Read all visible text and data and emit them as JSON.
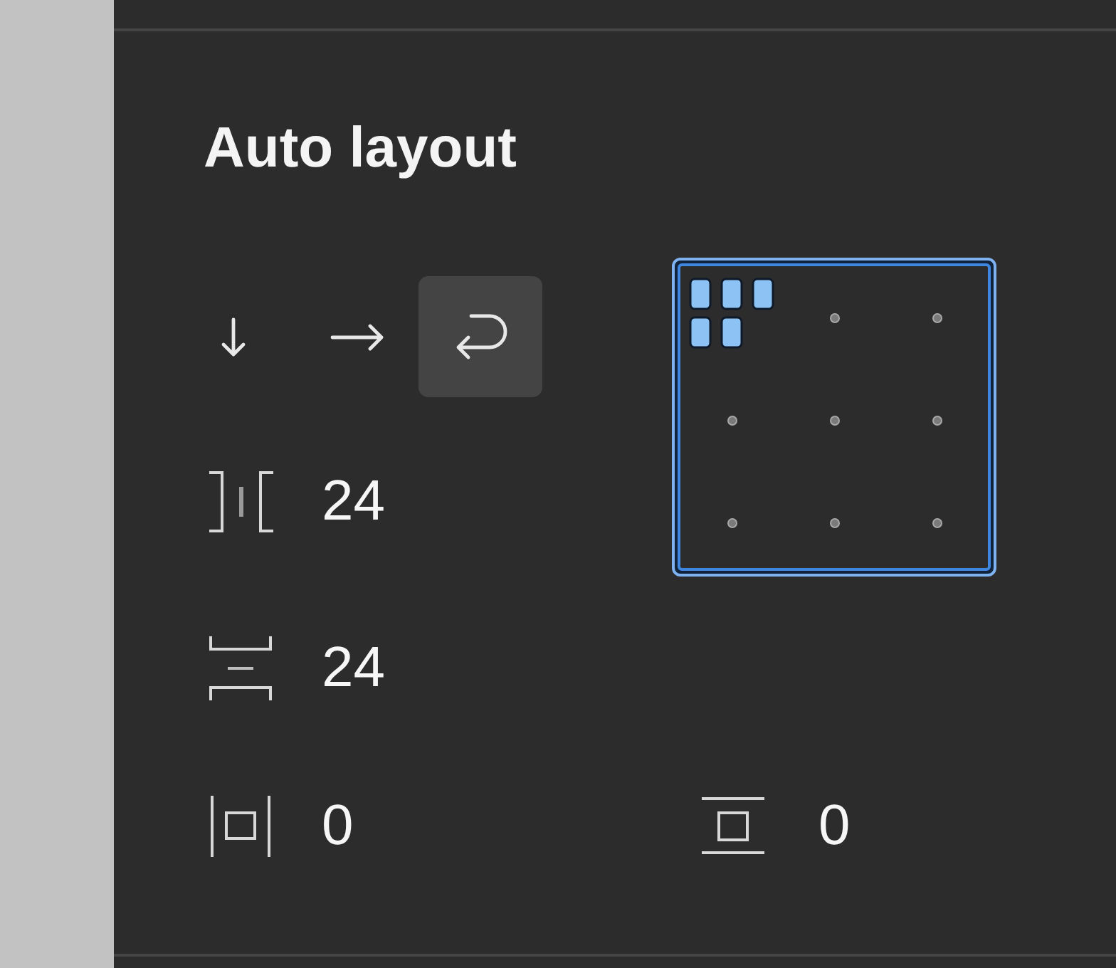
{
  "panel": {
    "title": "Auto layout"
  },
  "direction_buttons": [
    {
      "kind": "vertical",
      "selected": false
    },
    {
      "kind": "horizontal",
      "selected": false
    },
    {
      "kind": "wrap",
      "selected": true
    }
  ],
  "spacing": [
    {
      "kind": "horizontal-gap",
      "value": "24"
    },
    {
      "kind": "vertical-gap",
      "value": "24"
    }
  ],
  "alignment": {
    "cells": [
      {
        "selected": true
      },
      {
        "selected": false
      },
      {
        "selected": false
      },
      {
        "selected": false
      },
      {
        "selected": false
      },
      {
        "selected": false
      },
      {
        "selected": false
      },
      {
        "selected": false
      },
      {
        "selected": false
      }
    ]
  },
  "padding": [
    {
      "kind": "horizontal",
      "value": "0"
    },
    {
      "kind": "vertical",
      "value": "0"
    }
  ]
}
